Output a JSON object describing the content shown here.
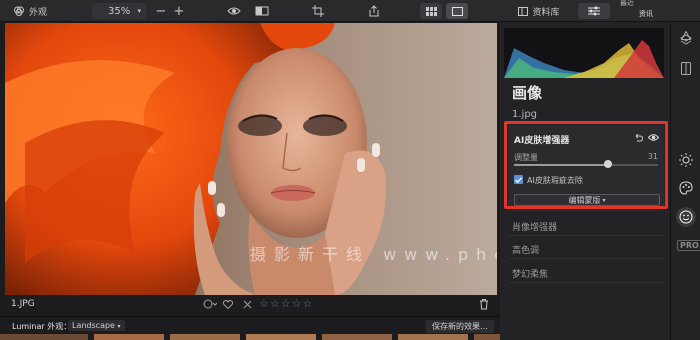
{
  "toolbar": {
    "looks_label": "外观",
    "zoom_value": "35%",
    "zoom_out_symbol": "−",
    "zoom_in_symbol": "+",
    "library_tab": "资料库",
    "adjust_tab": "编辑",
    "recent_label_line1": "最近",
    "recent_label_line2": "资讯"
  },
  "photo": {
    "watermark": "摄影新干线 www.photoshocks.vip"
  },
  "panel": {
    "title": "画像",
    "file_name": "1.jpg",
    "ai_tool": {
      "title": "AI皮肤增强器",
      "amount_label": "调整量",
      "amount_value": "31",
      "amount_fraction": 0.31,
      "checkbox_label": "AI皮肤瑕疵去除",
      "checkbox_checked": true,
      "mask_button": "编辑蒙版"
    },
    "tools": [
      {
        "label": "肖像增强器"
      },
      {
        "label": "高色调"
      },
      {
        "label": "梦幻柔焦"
      }
    ],
    "right_strip": {
      "pro_label": "PRO"
    },
    "histogram": {
      "colors": [
        "#3d8ac4",
        "#4cbf7a",
        "#e9c23a",
        "#d23a3a",
        "#ffffff"
      ]
    },
    "highlight_color": "#e0352b"
  },
  "infobar": {
    "image_name": "1.JPG",
    "rating_stars": "☆☆☆☆☆",
    "rating": 0
  },
  "looks": {
    "label": "Luminar 外观：",
    "selected": "Landscape",
    "save_button": "保存新的效果..."
  },
  "colors": {
    "background": "#1c1c1e",
    "panel": "#232326",
    "accent_check": "#5d8fd6"
  },
  "icons": [
    "looks-icon",
    "compare-eye-icon",
    "split-view-icon",
    "crop-icon",
    "share-icon",
    "grid-view-icon",
    "single-view-icon",
    "library-icon",
    "sliders-icon",
    "triangle-icon",
    "layers-icon",
    "filmstrip-icon",
    "sun-icon",
    "palette-icon",
    "face-icon",
    "undo-icon",
    "eye-icon",
    "info-icon",
    "heart-icon",
    "reject-icon",
    "trash-icon"
  ]
}
